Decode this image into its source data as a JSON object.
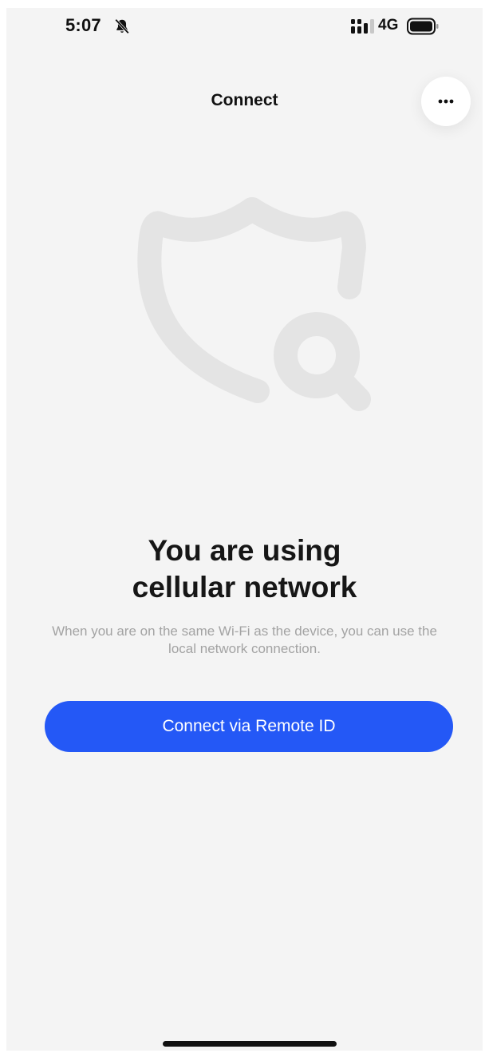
{
  "status_bar": {
    "time": "5:07",
    "network": "4G",
    "icons": [
      "bell-slash-icon",
      "signal-icon",
      "battery-icon"
    ]
  },
  "header": {
    "title": "Connect",
    "more_icon": "ellipsis-icon"
  },
  "illustration": {
    "icon": "shield-search-icon"
  },
  "main": {
    "heading_line1": "You are using",
    "heading_line2": "cellular network",
    "description": "When you are on the same Wi-Fi as the device, you can use the local network connection.",
    "connect_button_label": "Connect via Remote ID"
  },
  "colors": {
    "background": "#f4f4f4",
    "primary_button": "#2458f6",
    "subtext": "#a3a3a3",
    "illustration": "#e4e4e4"
  }
}
